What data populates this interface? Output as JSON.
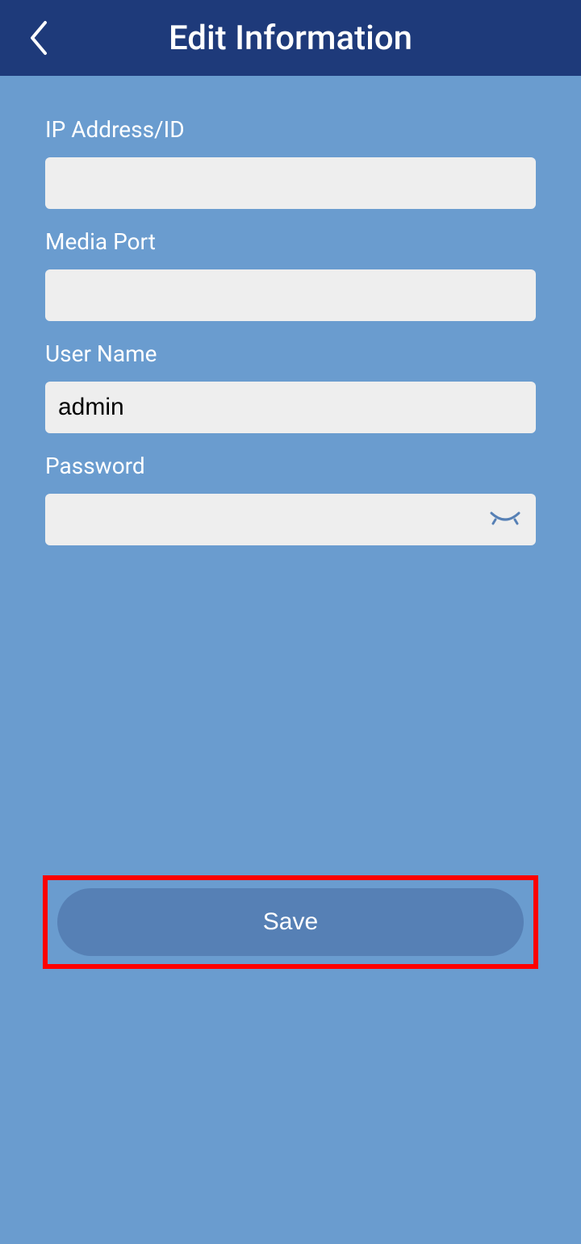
{
  "header": {
    "title": "Edit Information"
  },
  "form": {
    "ip_address": {
      "label": "IP Address/ID",
      "value": ""
    },
    "media_port": {
      "label": "Media Port",
      "value": ""
    },
    "user_name": {
      "label": "User Name",
      "value": "admin"
    },
    "password": {
      "label": "Password",
      "value": ""
    }
  },
  "actions": {
    "save_label": "Save"
  }
}
